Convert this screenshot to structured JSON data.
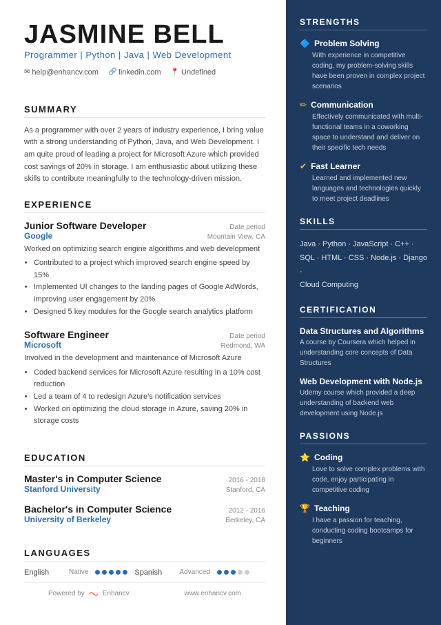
{
  "header": {
    "name": "JASMINE BELL",
    "subtitle": "Programmer | Python | Java | Web Development",
    "contact": {
      "email": "help@enhancv.com",
      "linkedin": "linkedin.com",
      "location": "Undefined"
    }
  },
  "summary": {
    "title": "SUMMARY",
    "text": "As a programmer with over 2 years of industry experience, I bring value with a strong understanding of Python, Java, and Web Development. I am quite proud of leading a project for Microsoft Azure which provided cost savings of 20% in storage. I am enthusiastic about utilizing these skills to contribute meaningfully to the technology-driven mission."
  },
  "experience": {
    "title": "EXPERIENCE",
    "items": [
      {
        "title": "Junior Software Developer",
        "date": "Date period",
        "company": "Google",
        "location": "Mountain View, CA",
        "description": "Worked on optimizing search engine algorithms and web development",
        "bullets": [
          "Contributed to a project which improved search engine speed by 15%",
          "Implemented UI changes to the landing pages of Google AdWords, improving user engagement by 20%",
          "Designed 5 key modules for the Google search analytics platform"
        ]
      },
      {
        "title": "Software Engineer",
        "date": "Date period",
        "company": "Microsoft",
        "location": "Redmond, WA",
        "description": "Involved in the development and maintenance of Microsoft Azure",
        "bullets": [
          "Coded backend services for Microsoft Azure resulting in a 10% cost reduction",
          "Led a team of 4 to redesign Azure's notification services",
          "Worked on optimizing the cloud storage in Azure, saving 20% in storage costs"
        ]
      }
    ]
  },
  "education": {
    "title": "EDUCATION",
    "items": [
      {
        "degree": "Master's in Computer Science",
        "years": "2016 - 2018",
        "school": "Stanford University",
        "location": "Stanford, CA"
      },
      {
        "degree": "Bachelor's in Computer Science",
        "years": "2012 - 2016",
        "school": "University of Berkeley",
        "location": "Berkeley, CA"
      }
    ]
  },
  "languages": {
    "title": "LANGUAGES",
    "items": [
      {
        "name": "English",
        "level": "Native",
        "filled": 5,
        "total": 5
      },
      {
        "name": "Spanish",
        "level": "Advanced",
        "filled": 3,
        "total": 5
      }
    ]
  },
  "strengths": {
    "title": "STRENGTHS",
    "items": [
      {
        "icon": "🔷",
        "name": "Problem Solving",
        "desc": "With experience in competitive coding, my problem-solving skills have been proven in complex project scenarios"
      },
      {
        "icon": "✏️",
        "name": "Communication",
        "desc": "Effectively communicated with multi-functional teams in a coworking space to understand and deliver on their specific tech needs"
      },
      {
        "icon": "✔",
        "name": "Fast Learner",
        "desc": "Learned and implemented new languages and technologies quickly to meet project deadlines"
      }
    ]
  },
  "skills": {
    "title": "SKILLS",
    "line1": "Java · Python · JavaScript · C++ ·",
    "line2": "SQL · HTML · CSS · Node.js · Django ·",
    "line3": "Cloud Computing"
  },
  "certification": {
    "title": "CERTIFICATION",
    "items": [
      {
        "title": "Data Structures and Algorithms",
        "desc": "A course by Coursera which helped in understanding core concepts of Data Structures"
      },
      {
        "title": "Web Development with Node.js",
        "desc": "Udemy course which provided a deep understanding of backend web development using Node.js"
      }
    ]
  },
  "passions": {
    "title": "PASSIONS",
    "items": [
      {
        "icon": "⭐",
        "name": "Coding",
        "desc": "Love to solve complex problems with code, enjoy participating in competitive coding"
      },
      {
        "icon": "🏆",
        "name": "Teaching",
        "desc": "I have a passion for teaching, conducting coding bootcamps for beginners"
      }
    ]
  },
  "footer": {
    "powered_by": "Powered by",
    "logo": "Enhancv",
    "website": "www.enhancv.com"
  }
}
